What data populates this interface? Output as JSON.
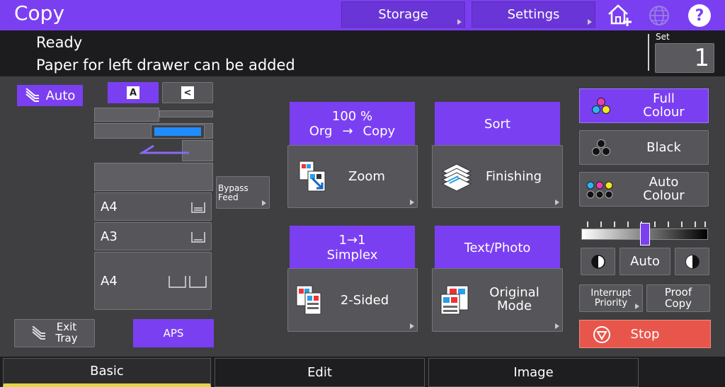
{
  "header": {
    "title": "Copy",
    "storage_label": "Storage",
    "settings_label": "Settings"
  },
  "status": {
    "line1": "Ready",
    "line2": "Paper for left drawer can be added",
    "set_label": "Set",
    "set_value": "1"
  },
  "paper": {
    "auto_label": "Auto",
    "bypass_label_1": "Bypass",
    "bypass_label_2": "Feed",
    "drawers": [
      "A4",
      "A3",
      "A4"
    ],
    "exit_tray_1": "Exit",
    "exit_tray_2": "Tray",
    "aps_label": "APS"
  },
  "zoom": {
    "value_line1": "100 %",
    "value_org": "Org",
    "value_arrow": "→",
    "value_copy": "Copy",
    "button_label": "Zoom"
  },
  "finishing": {
    "value": "Sort",
    "button_label": "Finishing"
  },
  "sided": {
    "value_line1": "1→1",
    "value_line2": "Simplex",
    "button_label": "2-Sided"
  },
  "original": {
    "value": "Text/Photo",
    "button_label_1": "Original",
    "button_label_2": "Mode"
  },
  "colour": {
    "full_1": "Full",
    "full_2": "Colour",
    "black": "Black",
    "auto_1": "Auto",
    "auto_2": "Colour"
  },
  "density": {
    "auto_label": "Auto",
    "level": 0.5
  },
  "actions": {
    "interrupt_1": "Interrupt",
    "interrupt_2": "Priority",
    "proof_1": "Proof",
    "proof_2": "Copy",
    "stop": "Stop"
  },
  "tabs": [
    "Basic",
    "Edit",
    "Image"
  ],
  "colors": {
    "accent": "#7b3ff2",
    "stop": "#e8564b",
    "tab_active": "#e4d44a"
  }
}
